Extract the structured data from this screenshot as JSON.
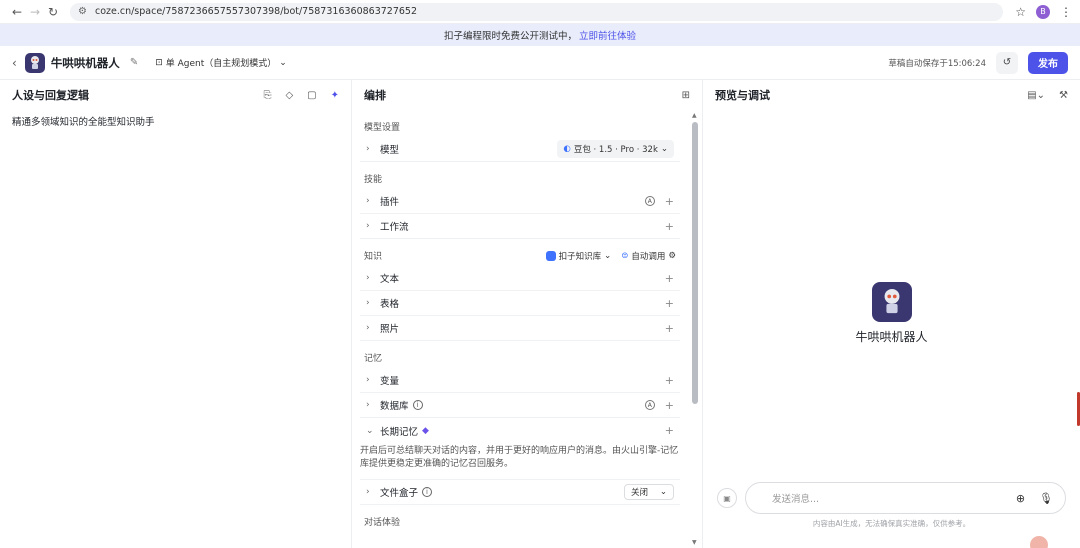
{
  "browser": {
    "url": "coze.cn/space/7587236657557307398/bot/7587316360863727652",
    "profile_initial": "B"
  },
  "banner": {
    "text": "扣子编程限时免费公开测试中，",
    "link": "立即前往体验"
  },
  "header": {
    "bot_name": "牛哄哄机器人",
    "mode_label": "单 Agent（自主规划模式）",
    "save_status": "草稿自动保存于15:06:24",
    "publish_label": "发布"
  },
  "left": {
    "title": "人设与回复逻辑",
    "prompt": "精通多领域知识的全能型知识助手"
  },
  "middle": {
    "title": "编排",
    "model_section": "模型设置",
    "model_label": "模型",
    "model_value": "豆包 · 1.5 · Pro · 32k",
    "skills_section": "技能",
    "plugins": "插件",
    "workflow": "工作流",
    "knowledge_section": "知识",
    "kb_source": "扣子知识库",
    "auto_call": "自动调用",
    "text": "文本",
    "table": "表格",
    "photo": "照片",
    "memory_section": "记忆",
    "variables": "变量",
    "database": "数据库",
    "long_memory": "长期记忆",
    "long_memory_desc": "开启后可总结聊天对话的内容，并用于更好的响应用户的消息。由火山引擎-记忆库提供更稳定更准确的记忆召回服务。",
    "file_box": "文件盒子",
    "file_box_value": "关闭",
    "dialog_section": "对话体验"
  },
  "right": {
    "title": "预览与调试",
    "bot_name": "牛哄哄机器人",
    "input_placeholder": "发送消息...",
    "disclaimer": "内容由AI生成，无法确保真实准确，仅供参考。"
  },
  "colors": {
    "accent": "#4d53e8",
    "banner_bg": "#e9ecfb",
    "avatar_bg": "#3a3770"
  }
}
